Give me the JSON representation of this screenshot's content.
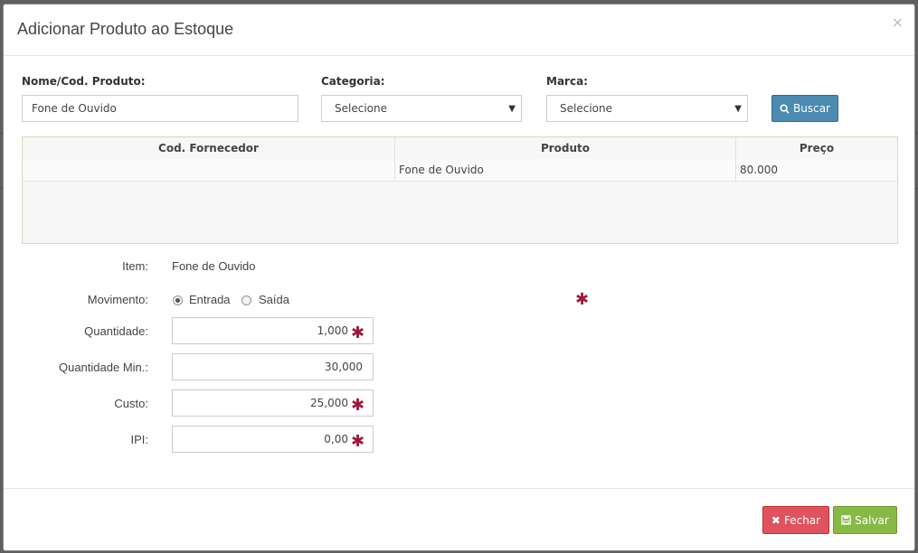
{
  "modal": {
    "title": "Adicionar Produto ao Estoque",
    "close": "×"
  },
  "filters": {
    "nome_label": "Nome/Cod. Produto:",
    "nome_value": "Fone de Ouvido",
    "categoria_label": "Categoria:",
    "categoria_value": "Selecione",
    "marca_label": "Marca:",
    "marca_value": "Selecione",
    "buscar_label": "Buscar"
  },
  "table": {
    "headers": [
      "Cod. Fornecedor",
      "Produto",
      "Preço"
    ],
    "rows": [
      [
        "",
        "Fone de Ouvido",
        "80.000"
      ]
    ]
  },
  "form": {
    "item_label": "Item:",
    "item_value": "Fone de Ouvido",
    "movimento_label": "Movimento:",
    "movimento_options": [
      "Entrada",
      "Saída"
    ],
    "movimento_selected": "Entrada",
    "quantidade_label": "Quantidade:",
    "quantidade_value": "1,000",
    "quantidade_min_label": "Quantidade Min.:",
    "quantidade_min_value": "30,000",
    "custo_label": "Custo:",
    "custo_value": "25,000",
    "ipi_label": "IPI:",
    "ipi_value": "0,00",
    "required_mark": "✱"
  },
  "footer": {
    "fechar_label": "Fechar",
    "salvar_label": "Salvar"
  },
  "colors": {
    "buscar": "#4b8ab1",
    "fechar": "#e0525d",
    "salvar": "#87b945",
    "required": "#a0193a"
  }
}
